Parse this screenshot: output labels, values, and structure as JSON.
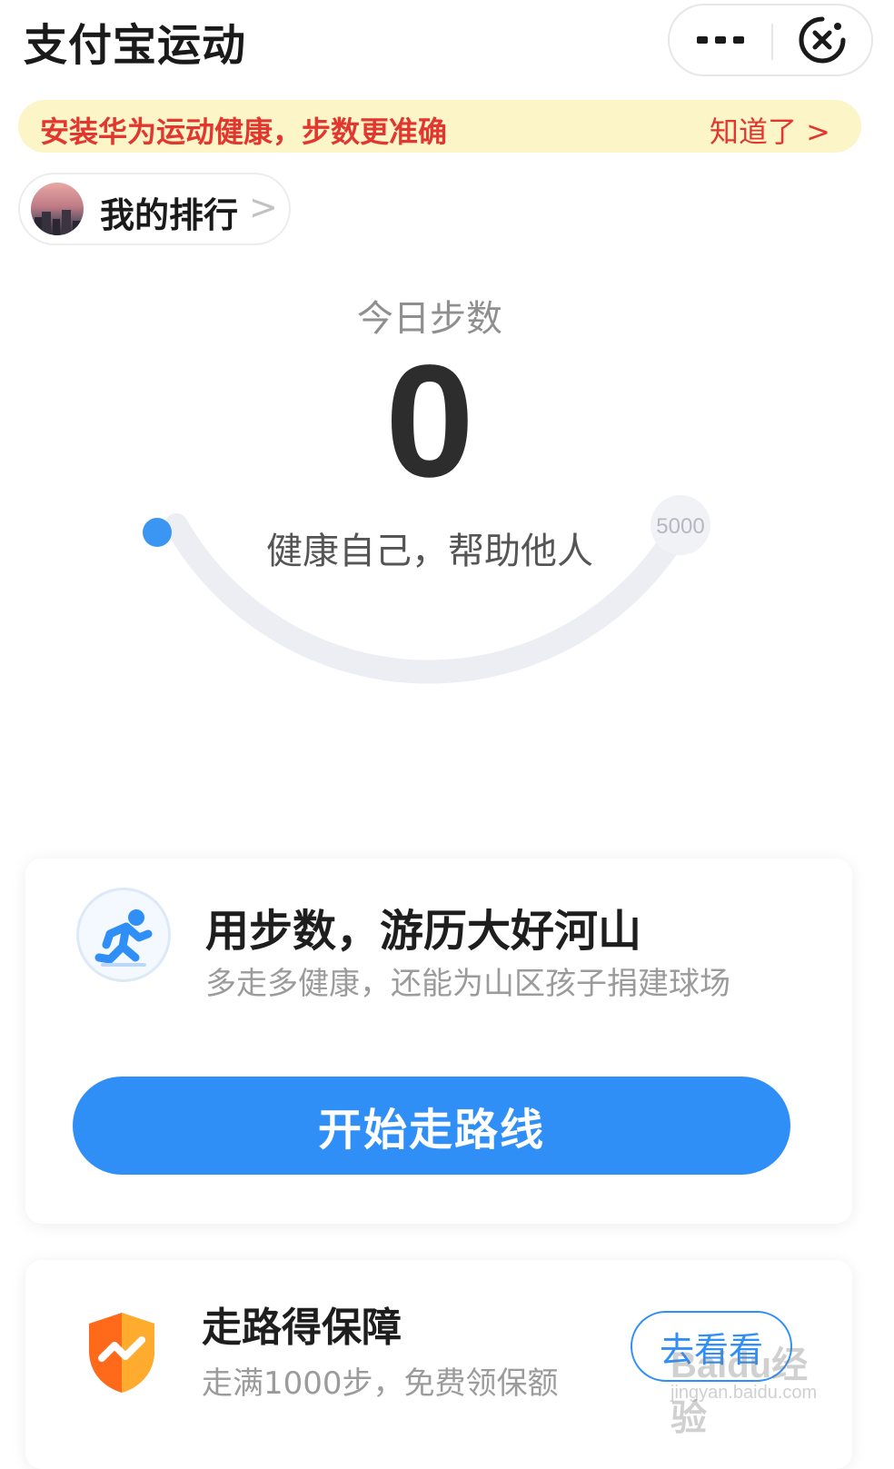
{
  "header": {
    "title": "支付宝运动",
    "more_icon": "more-dots-icon",
    "close_icon": "close-target-icon"
  },
  "notice": {
    "text": "安装华为运动健康，步数更准确",
    "link": "知道了 >"
  },
  "ranking": {
    "label": "我的排行",
    "chevron": ">"
  },
  "steps": {
    "caption": "今日步数",
    "value": "0",
    "slogan": "健康自己，帮助他人",
    "goal": "5000",
    "progress": 0
  },
  "route_card": {
    "title": "用步数，游历大好河山",
    "subtitle": "多走多健康，还能为山区孩子捐建球场",
    "button": "开始走路线"
  },
  "insurance_card": {
    "title": "走路得保障",
    "subtitle": "走满1000步，免费领保额",
    "button": "去看看"
  },
  "watermark": {
    "brand": "Baidu经验",
    "url": "jingyan.baidu.com"
  },
  "colors": {
    "accent": "#2f8ff7",
    "notice_bg": "#fcf5c8",
    "notice_text": "#e2372f",
    "track": "#eceef4"
  }
}
